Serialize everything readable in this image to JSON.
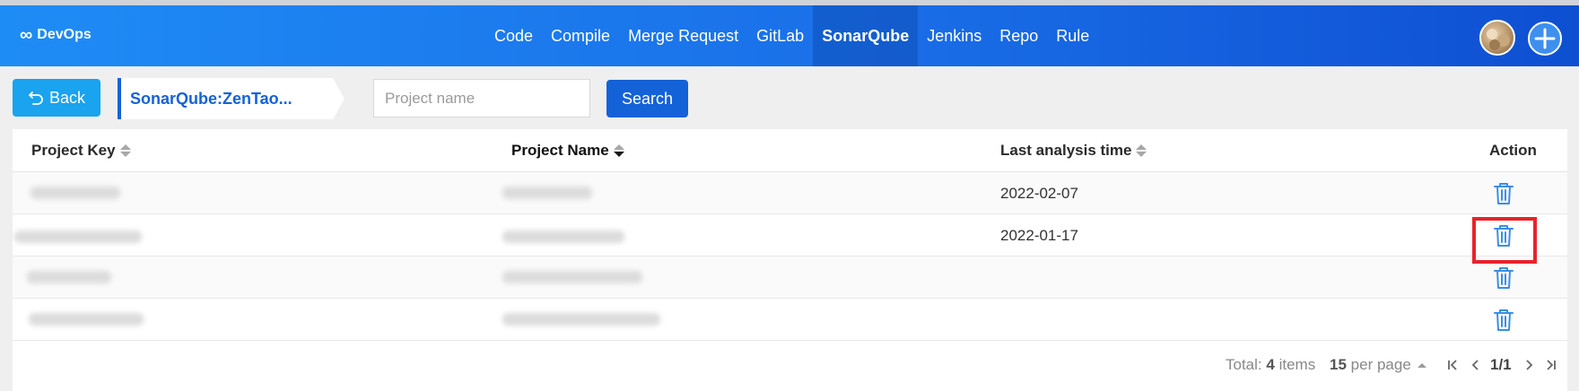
{
  "header": {
    "logo_text": "DevOps",
    "nav": [
      "Code",
      "Compile",
      "Merge Request",
      "GitLab",
      "SonarQube",
      "Jenkins",
      "Repo",
      "Rule"
    ],
    "active_nav": "SonarQube"
  },
  "toolbar": {
    "back_label": "Back",
    "breadcrumb": "SonarQube:ZenTao...",
    "search_placeholder": "Project name",
    "search_value": "",
    "search_label": "Search"
  },
  "table": {
    "columns": [
      "Project Key",
      "Project Name",
      "Last analysis time",
      "Action"
    ],
    "rows": [
      {
        "project_key": "",
        "project_name": "",
        "last_analysis_time": "2022-02-07"
      },
      {
        "project_key": "",
        "project_name": "",
        "last_analysis_time": "2022-01-17"
      },
      {
        "project_key": "",
        "project_name": "",
        "last_analysis_time": ""
      },
      {
        "project_key": "",
        "project_name": "",
        "last_analysis_time": ""
      }
    ]
  },
  "pagination": {
    "total_prefix": "Total:",
    "total": "4",
    "total_suffix": "items",
    "per_page_value": "15",
    "per_page_suffix": "per page",
    "page": "1/1"
  },
  "colors": {
    "nav_gradient_start": "#1e8cf5",
    "nav_gradient_end": "#0e4fd2",
    "primary": "#1362d8",
    "back_button": "#1aa3ef",
    "trash_icon": "#3a8ee6",
    "highlight_box": "#e8232b"
  }
}
